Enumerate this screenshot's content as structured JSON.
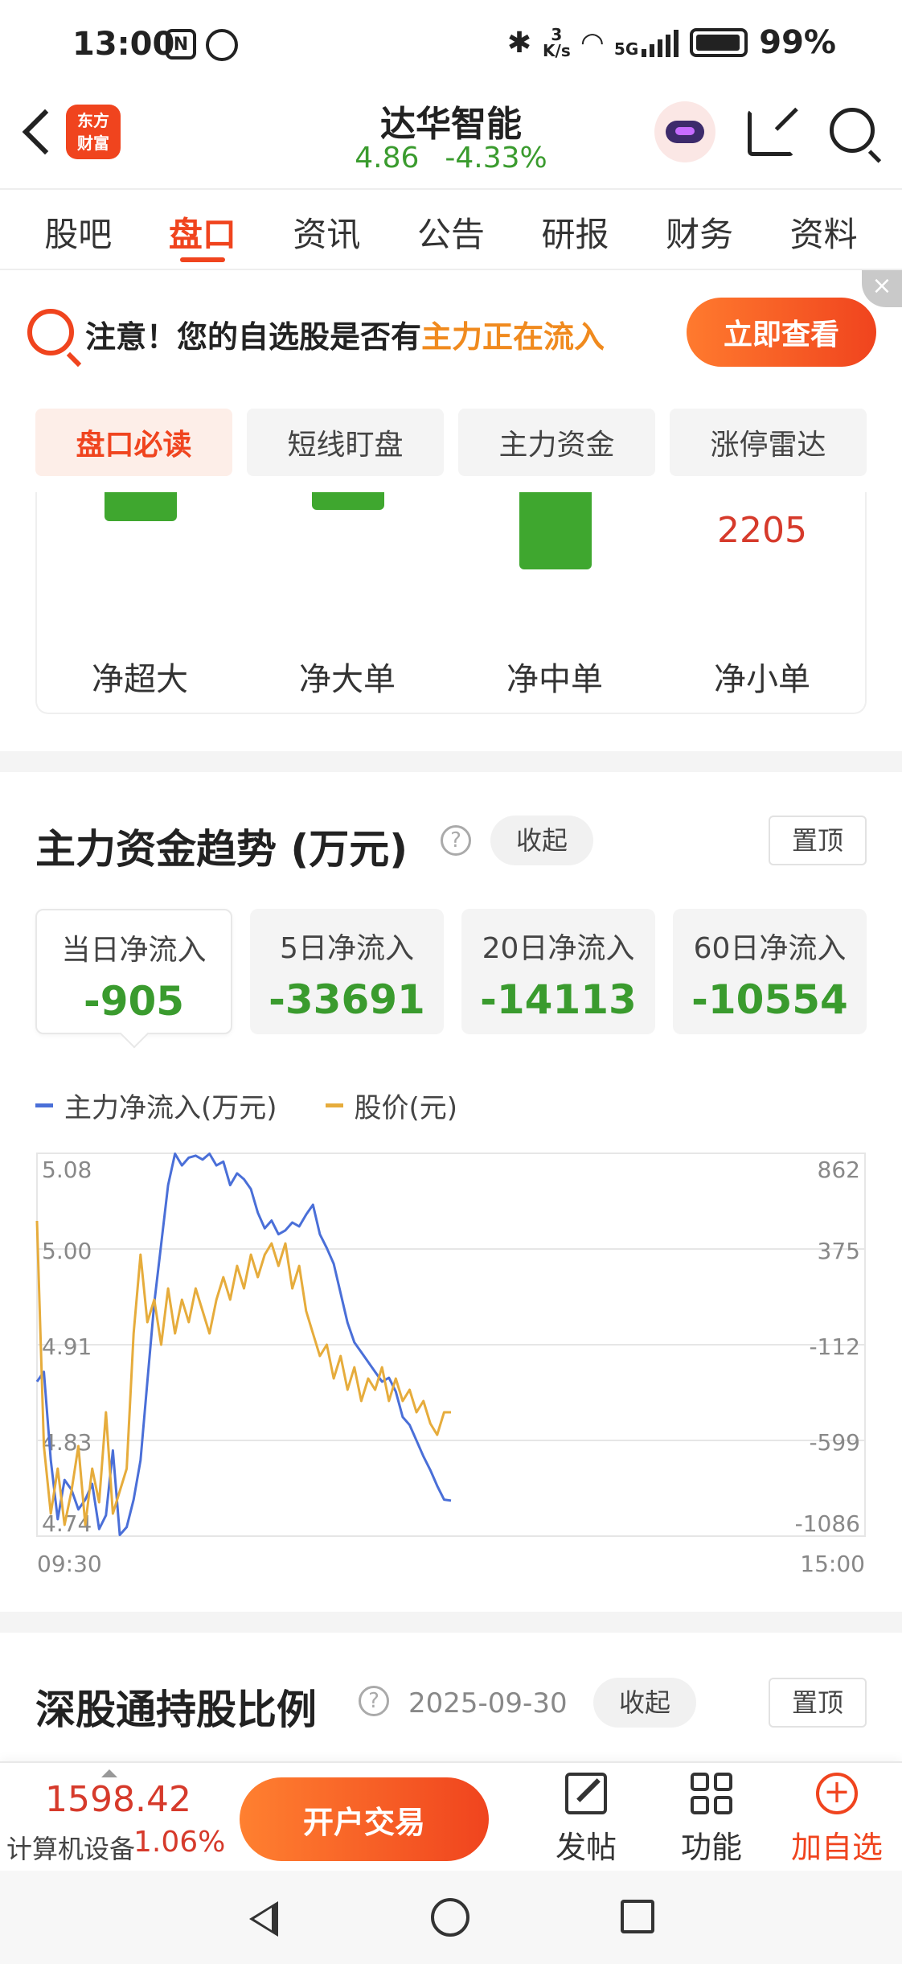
{
  "status": {
    "time": "13:00",
    "icons": [
      "nfc-icon",
      "alarm-icon",
      "bluetooth-icon",
      "wifi-icon",
      "signal-icon",
      "battery-icon"
    ],
    "net_speed_top": "3",
    "net_speed_bottom": "K/s",
    "network": "5G",
    "battery": "99%"
  },
  "header": {
    "logo_line1": "东方",
    "logo_line2": "财富",
    "stock_name": "达华智能",
    "price": "4.86",
    "change_pct": "-4.33%"
  },
  "tabs": [
    "股吧",
    "盘口",
    "资讯",
    "公告",
    "研报",
    "财务",
    "资料"
  ],
  "active_tab": "盘口",
  "notice": {
    "text_prefix": "注意！您的自选股是否有",
    "text_highlight": "主力正在流入",
    "button": "立即查看",
    "close": "×"
  },
  "subtabs": [
    "盘口必读",
    "短线盯盘",
    "主力资金",
    "涨停雷达"
  ],
  "active_subtab": "盘口必读",
  "net_flow_bars": {
    "labels": [
      "净超大",
      "净大单",
      "净中单",
      "净小单"
    ],
    "small_value": "2205"
  },
  "trend": {
    "title": "主力资金趋势 (万元)",
    "help": "?",
    "collapse": "收起",
    "pin": "置顶",
    "flows": [
      {
        "label": "当日净流入",
        "value": "-905"
      },
      {
        "label": "5日净流入",
        "value": "-33691"
      },
      {
        "label": "20日净流入",
        "value": "-14113"
      },
      {
        "label": "60日净流入",
        "value": "-10554"
      }
    ],
    "legend": {
      "net_inflow": "主力净流入(万元)",
      "price": "股价(元)"
    }
  },
  "chart_data": {
    "type": "line",
    "left_ticks": [
      "5.08",
      "5.00",
      "4.91",
      "4.83",
      "4.74"
    ],
    "right_ticks": [
      "862",
      "375",
      "-112",
      "-599",
      "-1086"
    ],
    "x_ticks": [
      "09:30",
      "15:00"
    ],
    "left_range": [
      4.74,
      5.08
    ],
    "right_range": [
      -1086,
      862
    ],
    "x_range": [
      0,
      240
    ],
    "series": [
      {
        "name": "主力净流入(万元)",
        "color": "#4a6fd8",
        "axis": "right",
        "x": [
          0,
          2,
          4,
          6,
          8,
          10,
          12,
          14,
          16,
          18,
          20,
          22,
          24,
          26,
          28,
          30,
          32,
          34,
          36,
          38,
          40,
          42,
          44,
          46,
          48,
          50,
          52,
          54,
          56,
          58,
          60,
          62,
          64,
          66,
          68,
          70,
          72,
          74,
          76,
          78,
          80,
          82,
          84,
          86,
          88,
          90,
          92,
          94,
          96,
          98,
          100,
          102,
          104,
          106,
          108,
          110,
          112,
          114,
          116,
          118,
          120
        ],
        "values": [
          -300,
          -250,
          -700,
          -1000,
          -800,
          -850,
          -950,
          -900,
          -820,
          -1050,
          -980,
          -650,
          -1080,
          -1040,
          -900,
          -700,
          -300,
          100,
          400,
          700,
          860,
          800,
          840,
          850,
          830,
          860,
          800,
          820,
          700,
          760,
          730,
          680,
          560,
          480,
          520,
          450,
          470,
          510,
          490,
          550,
          600,
          450,
          380,
          300,
          150,
          0,
          -100,
          -150,
          -200,
          -250,
          -300,
          -280,
          -350,
          -480,
          -520,
          -600,
          -680,
          -750,
          -830,
          -900,
          -905
        ]
      },
      {
        "name": "股价(元)",
        "color": "#e6ac3c",
        "axis": "left",
        "x": [
          0,
          2,
          4,
          6,
          8,
          10,
          12,
          14,
          16,
          18,
          20,
          22,
          24,
          26,
          28,
          30,
          32,
          34,
          36,
          38,
          40,
          42,
          44,
          46,
          48,
          50,
          52,
          54,
          56,
          58,
          60,
          62,
          64,
          66,
          68,
          70,
          72,
          74,
          76,
          78,
          80,
          82,
          84,
          86,
          88,
          90,
          92,
          94,
          96,
          98,
          100,
          102,
          104,
          106,
          108,
          110,
          112,
          114,
          116,
          118,
          120
        ],
        "values": [
          5.02,
          4.82,
          4.76,
          4.8,
          4.75,
          4.78,
          4.82,
          4.75,
          4.8,
          4.77,
          4.85,
          4.76,
          4.78,
          4.8,
          4.92,
          4.99,
          4.93,
          4.95,
          4.91,
          4.96,
          4.92,
          4.95,
          4.93,
          4.96,
          4.94,
          4.92,
          4.95,
          4.97,
          4.95,
          4.98,
          4.96,
          4.99,
          4.97,
          4.99,
          5.0,
          4.98,
          5.0,
          4.96,
          4.98,
          4.94,
          4.92,
          4.9,
          4.91,
          4.88,
          4.9,
          4.87,
          4.89,
          4.86,
          4.88,
          4.87,
          4.89,
          4.86,
          4.88,
          4.86,
          4.87,
          4.85,
          4.86,
          4.84,
          4.83,
          4.85,
          4.85
        ]
      }
    ]
  },
  "hk_section": {
    "title": "深股通持股比例",
    "help": "?",
    "date": "2025-09-30",
    "collapse": "收起",
    "pin": "置顶"
  },
  "bottom": {
    "index_value": "1598.42",
    "index_name": "计算机设备",
    "index_pct": "1.06%",
    "trade": "开户交易",
    "post": "发帖",
    "func": "功能",
    "add": "加自选",
    "add_icon": "+"
  },
  "colors": {
    "accent": "#f0441e",
    "down": "#3a9b2e",
    "up": "#d63a2b"
  }
}
